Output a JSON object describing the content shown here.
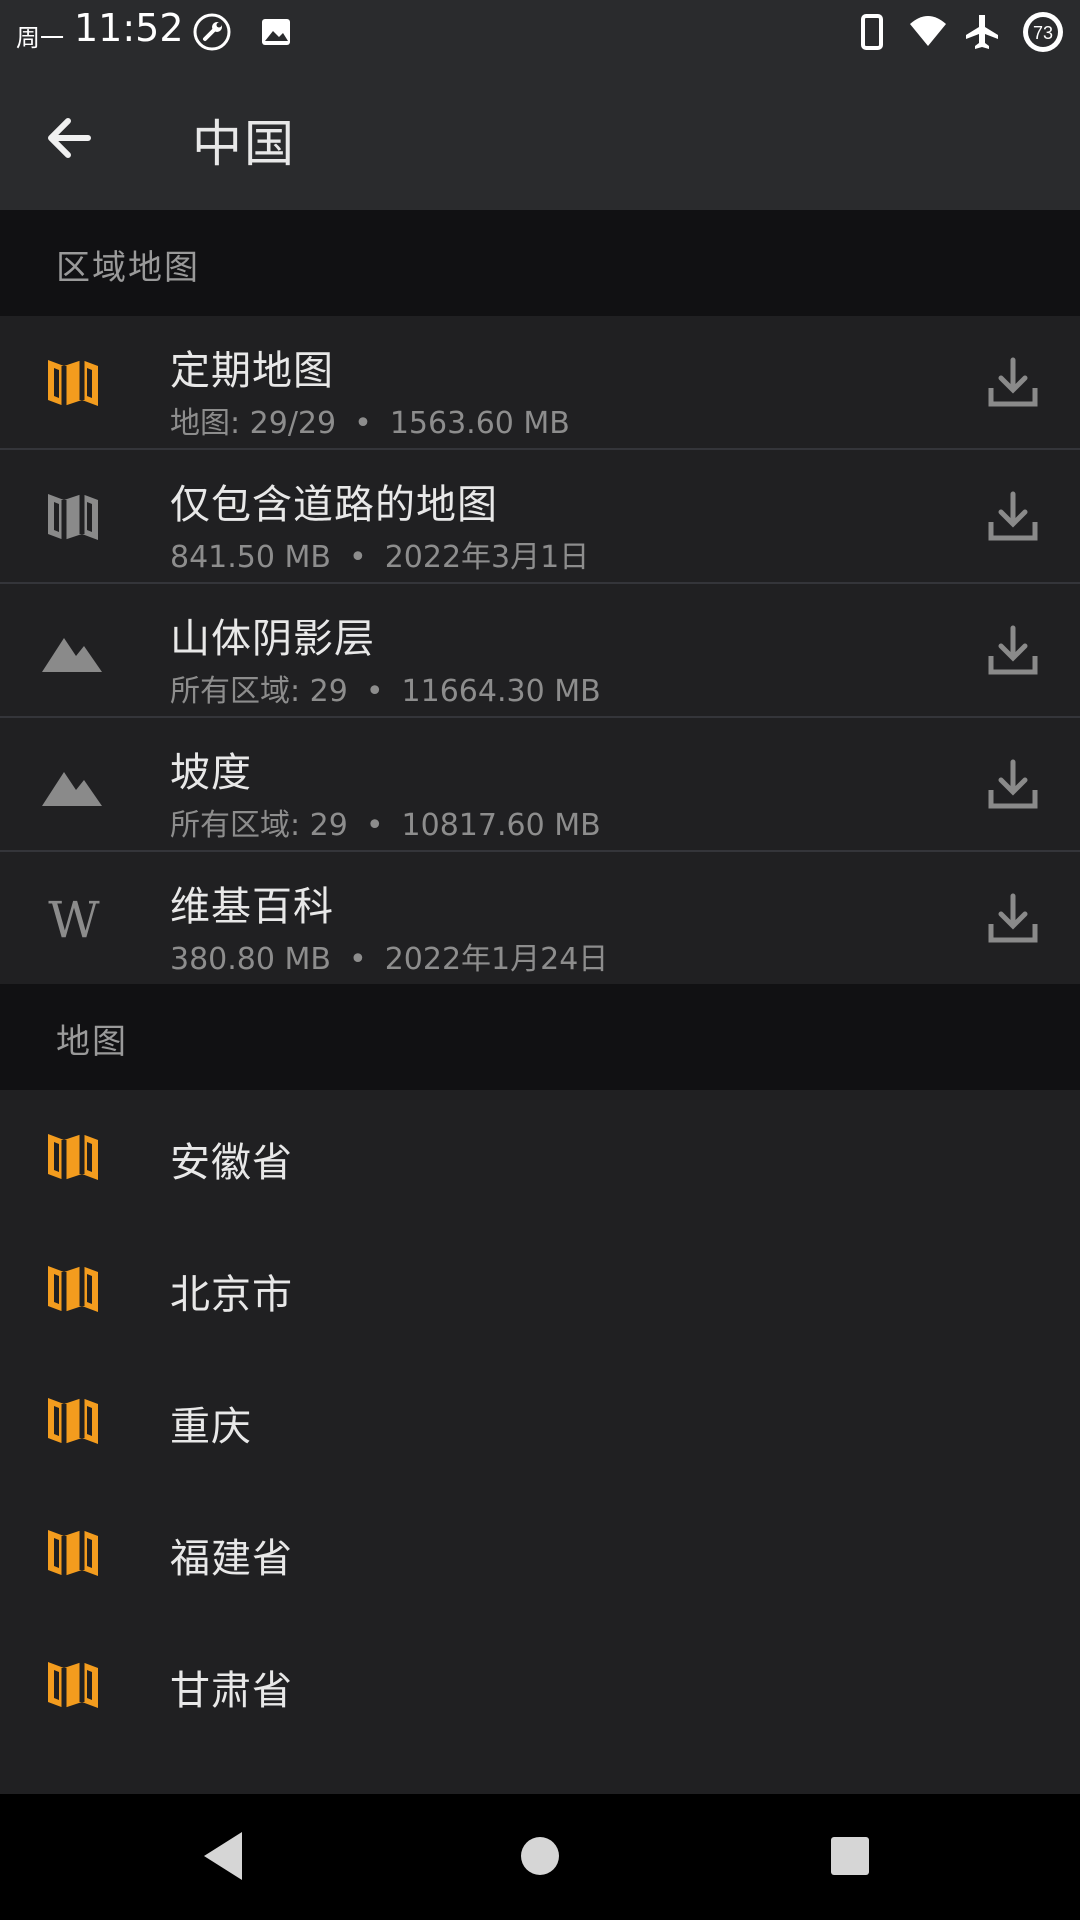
{
  "status_bar": {
    "day": "周一",
    "time": "11:52",
    "battery": "73"
  },
  "app_bar": {
    "title": "中国"
  },
  "sections": {
    "regional": {
      "header": "区域地图",
      "items": [
        {
          "title": "定期地图",
          "sub1": "地图: 29/29",
          "sub2": "1563.60 MB",
          "icon": "map-icon",
          "color": "#f39c1e"
        },
        {
          "title": "仅包含道路的地图",
          "sub1": "841.50 MB",
          "sub2": "2022年3月1日",
          "icon": "map-icon",
          "color": "#8a8a8a"
        },
        {
          "title": "山体阴影层",
          "sub1": "所有区域: 29",
          "sub2": "11664.30 MB",
          "icon": "mountain-icon",
          "color": "#8a8a8a"
        },
        {
          "title": "坡度",
          "sub1": "所有区域: 29",
          "sub2": "10817.60 MB",
          "icon": "mountain-icon",
          "color": "#8a8a8a"
        },
        {
          "title": "维基百科",
          "sub1": "380.80 MB",
          "sub2": "2022年1月24日",
          "icon": "wikipedia-icon",
          "glyph": "W",
          "color": "#8a8a8a"
        }
      ]
    },
    "maps": {
      "header": "地图",
      "items": [
        {
          "title": "安徽省"
        },
        {
          "title": "北京市"
        },
        {
          "title": "重庆"
        },
        {
          "title": "福建省"
        },
        {
          "title": "甘肃省"
        }
      ]
    }
  },
  "colors": {
    "accent": "#f39c1e",
    "background": "#202022",
    "header_bg": "#111113",
    "appbar_bg": "#2a2b2d",
    "muted_icon": "#8a8a8a"
  },
  "separator": "•"
}
